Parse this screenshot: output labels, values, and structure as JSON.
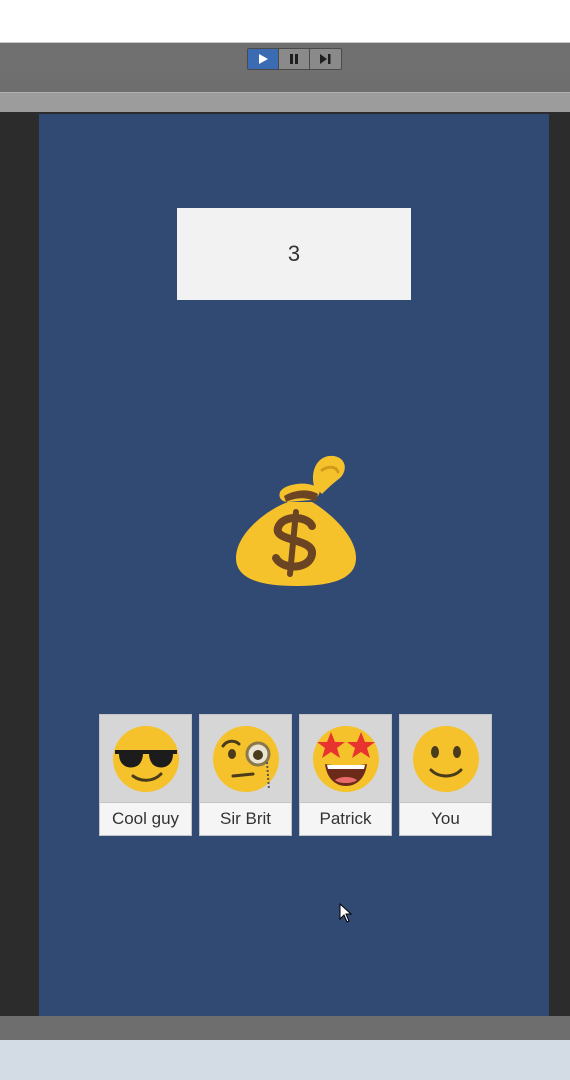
{
  "editor": {
    "play_controls": {
      "play_icon": "play-icon",
      "pause_icon": "pause-icon",
      "step_icon": "step-icon",
      "active_color": "#3a6bb3"
    }
  },
  "game": {
    "background_color": "#314a73",
    "countdown": "3",
    "center_icon": "money-bag-icon",
    "players": [
      {
        "name": "Cool guy",
        "icon": "sunglasses-face-icon"
      },
      {
        "name": "Sir Brit",
        "icon": "monocle-face-icon"
      },
      {
        "name": "Patrick",
        "icon": "star-struck-face-icon"
      },
      {
        "name": "You",
        "icon": "slightly-smiling-face-icon"
      }
    ]
  }
}
